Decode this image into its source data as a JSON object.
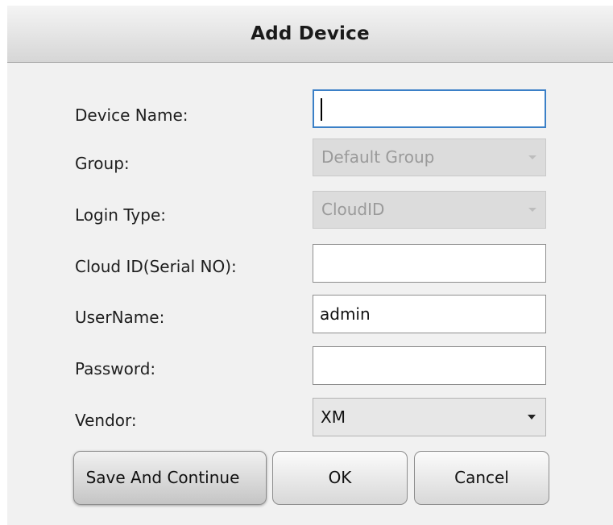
{
  "dialog": {
    "title": "Add Device"
  },
  "form": {
    "device_name": {
      "label": "Device Name:",
      "value": ""
    },
    "group": {
      "label": "Group:",
      "value": "Default Group"
    },
    "login_type": {
      "label": "Login Type:",
      "value": "CloudID"
    },
    "cloud_id": {
      "label": "Cloud ID(Serial NO):",
      "value": ""
    },
    "username": {
      "label": "UserName:",
      "value": "admin"
    },
    "password": {
      "label": "Password:",
      "value": ""
    },
    "vendor": {
      "label": "Vendor:",
      "value": "XM"
    }
  },
  "buttons": {
    "save_continue": "Save And Continue",
    "ok": "OK",
    "cancel": "Cancel"
  },
  "icons": {
    "dropdown": "chevron-down-icon"
  },
  "colors": {
    "focus_border": "#3b80c7",
    "disabled_fill": "#dcdcdc",
    "dialog_bg": "#f1f1f1"
  }
}
